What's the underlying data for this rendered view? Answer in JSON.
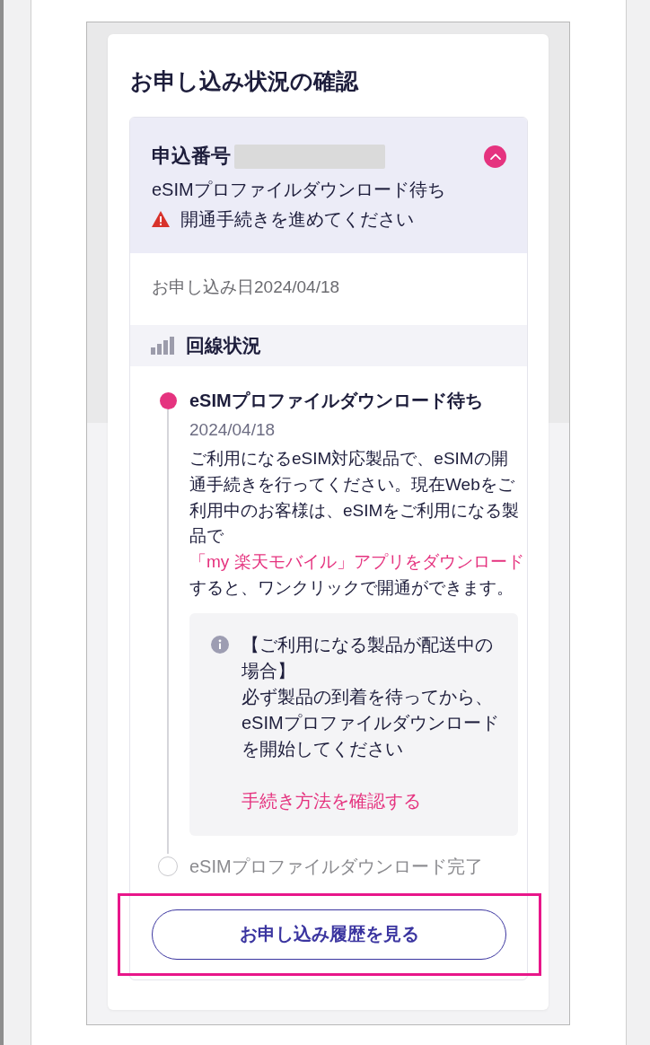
{
  "page": {
    "title": "お申し込み状況の確認"
  },
  "application": {
    "expanded": true,
    "number_label": "申込番号",
    "number_redacted": true,
    "status": "eSIMプロファイルダウンロード待ち",
    "warning": "開通手続きを進めてください",
    "date": "お申し込み日2024/04/18"
  },
  "line_status": {
    "title": "回線状況",
    "steps": [
      {
        "active": true,
        "title": "eSIMプロファイルダウンロード待ち",
        "date": "2024/04/18",
        "description": {
          "text_before_link": "ご利用になるeSIM対応製品で、eSIMの開通手続きを行ってください。現在Webをご利用中のお客様は、eSIMをご利用になる製品で",
          "link": "「my 楽天モバイル」アプリをダウンロード",
          "text_after_link": "すると、ワンクリックで開通ができます。"
        },
        "note": {
          "heading": "【ご利用になる製品が配送中の場合】",
          "text": "必ず製品の到着を待ってから、eSIMプロファイルダウンロードを開始してください",
          "link": "手続き方法を確認する"
        }
      },
      {
        "active": false,
        "title": "eSIMプロファイルダウンロード完了"
      }
    ]
  },
  "history_button": {
    "label": "お申し込み履歴を見る",
    "highlighted": true
  }
}
